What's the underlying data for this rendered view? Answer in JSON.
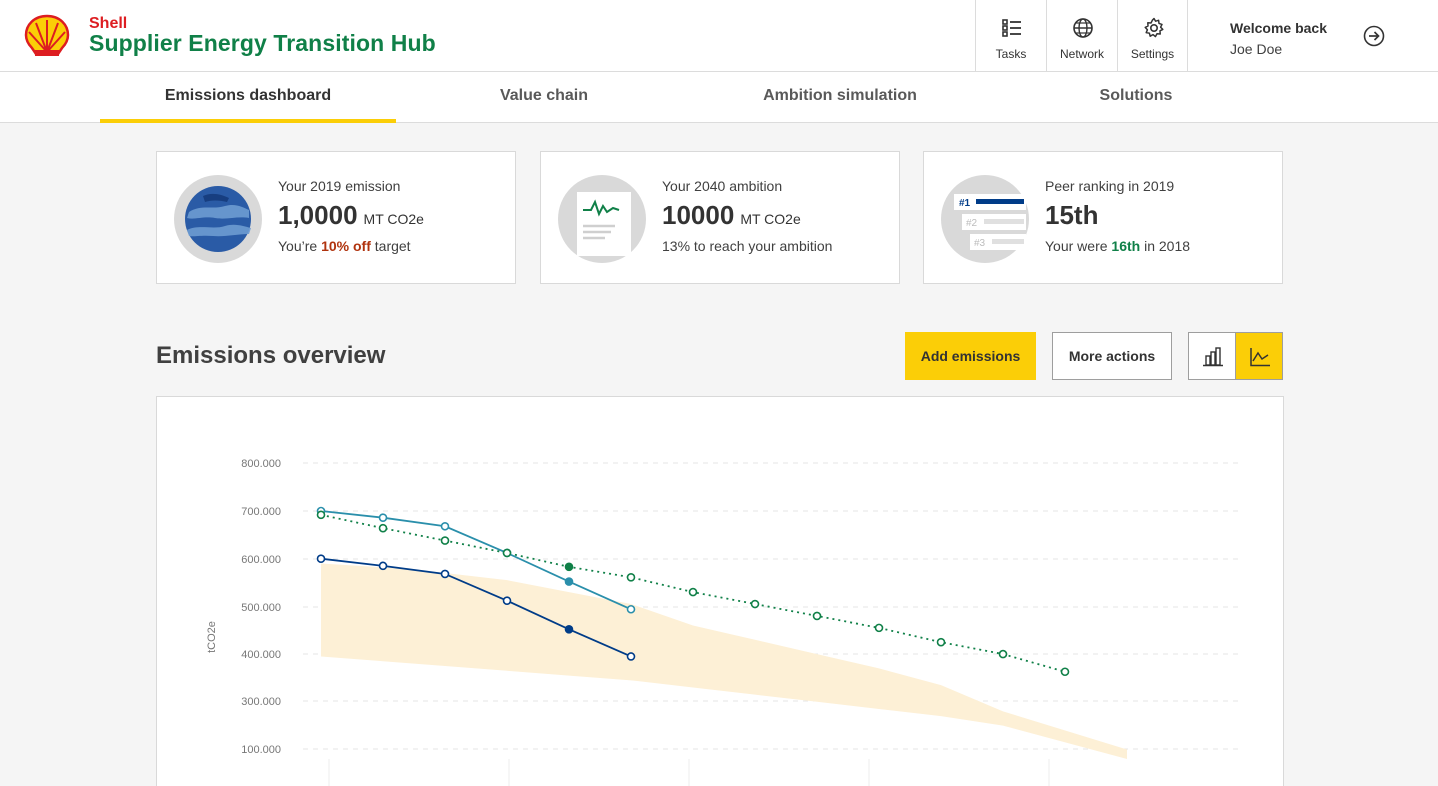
{
  "header": {
    "brand_small": "Shell",
    "brand_title": "Supplier Energy Transition Hub",
    "nav_buttons": [
      {
        "label": "Tasks",
        "icon": "list-icon"
      },
      {
        "label": "Network",
        "icon": "globe-icon"
      },
      {
        "label": "Settings",
        "icon": "gear-icon"
      }
    ],
    "welcome": "Welcome back",
    "user_name": "Joe Doe"
  },
  "tabs": [
    {
      "label": "Emissions dashboard",
      "active": true
    },
    {
      "label": "Value chain",
      "active": false
    },
    {
      "label": "Ambition simulation",
      "active": false
    },
    {
      "label": "Solutions",
      "active": false
    }
  ],
  "cards": [
    {
      "label": "Your 2019 emission",
      "value": "1,0000",
      "unit": "MT CO2e",
      "sub_pre": "You’re ",
      "sub_hl": "10% off",
      "sub_post": " target"
    },
    {
      "label": "Your 2040 ambition",
      "value": "10000",
      "unit": "MT CO2e",
      "sub": "13% to reach your ambition"
    },
    {
      "label": "Peer ranking in 2019",
      "value": "15th",
      "sub_pre": "Your were ",
      "sub_hl": "16th",
      "sub_post": " in 2018",
      "rank_labels": [
        "#1",
        "#2",
        "#3"
      ]
    }
  ],
  "overview": {
    "title": "Emissions overview",
    "add_button": "Add emissions",
    "more_button": "More actions",
    "view_toggle": {
      "options": [
        "bar-chart-icon",
        "line-chart-icon"
      ],
      "active": "line-chart-icon"
    }
  },
  "colors": {
    "brand_red": "#dd1d21",
    "brand_yellow": "#fbce07",
    "brand_green": "#108048",
    "series_dark_blue": "#003c88",
    "series_teal": "#2a8fab",
    "series_green": "#108048",
    "band_fill": "#fdf0d6"
  },
  "chart_data": {
    "type": "line",
    "ylabel": "tCO2e",
    "y_ticks": [
      "800.000",
      "700.000",
      "600.000",
      "500.000",
      "400.000",
      "300.000",
      "100.000"
    ],
    "grid": true,
    "series": [
      {
        "x": [
          1,
          2,
          3,
          4,
          5,
          6
        ],
        "y": [
          600,
          585,
          568,
          512,
          452,
          395
        ],
        "style": "solid",
        "color": "#003c88",
        "filled_index": 4
      },
      {
        "x": [
          1,
          2,
          3,
          4,
          5,
          6
        ],
        "y": [
          700,
          686,
          668,
          612,
          552,
          494
        ],
        "style": "solid",
        "color": "#2a8fab",
        "filled_index": 4
      },
      {
        "x": [
          1,
          2,
          3,
          4,
          5,
          6,
          7,
          8,
          9,
          10,
          11,
          12,
          13
        ],
        "y": [
          692,
          664,
          638,
          612,
          583,
          561,
          530,
          505,
          480,
          455,
          425,
          400,
          363
        ],
        "style": "dotted",
        "color": "#108048",
        "filled_index": 4
      }
    ],
    "band": {
      "x": [
        1,
        2,
        3,
        4,
        5,
        6,
        7,
        8,
        9,
        10,
        11,
        12,
        14
      ],
      "upper": [
        590,
        582,
        570,
        555,
        530,
        505,
        460,
        430,
        400,
        370,
        335,
        280,
        200
      ],
      "lower": [
        395,
        385,
        375,
        365,
        355,
        345,
        330,
        315,
        300,
        285,
        270,
        250,
        180
      ]
    }
  }
}
